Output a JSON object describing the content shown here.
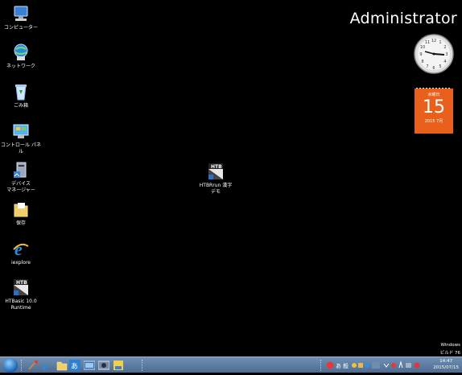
{
  "desktop": {
    "icons": [
      {
        "label": "コンピューター",
        "label2": ""
      },
      {
        "label": "ネットワーク",
        "label2": ""
      },
      {
        "label": "ごみ箱",
        "label2": ""
      },
      {
        "label": "コントロール パネ",
        "label2": "ル"
      },
      {
        "label": "デバイス",
        "label2": "マネージャー"
      },
      {
        "label": "保存",
        "label2": ""
      },
      {
        "label": "iexplore",
        "label2": ""
      },
      {
        "label": "HTBasic 10.0",
        "label2": "Runtime"
      },
      {
        "label": "HTBRrun  漢字",
        "label2": "デモ"
      }
    ],
    "htb_badge": "HTB"
  },
  "gadgets": {
    "user_name": "Administrator",
    "calendar": {
      "weekday": "水曜日",
      "day": "15",
      "year_month": "2015 7月",
      "color": "#e8601c"
    }
  },
  "watermark": {
    "line1": "Windows",
    "line2": "ビルド 76"
  },
  "taskbar": {
    "time": "14:47",
    "date": "2015/07/15",
    "color": "#5a7aa0"
  }
}
